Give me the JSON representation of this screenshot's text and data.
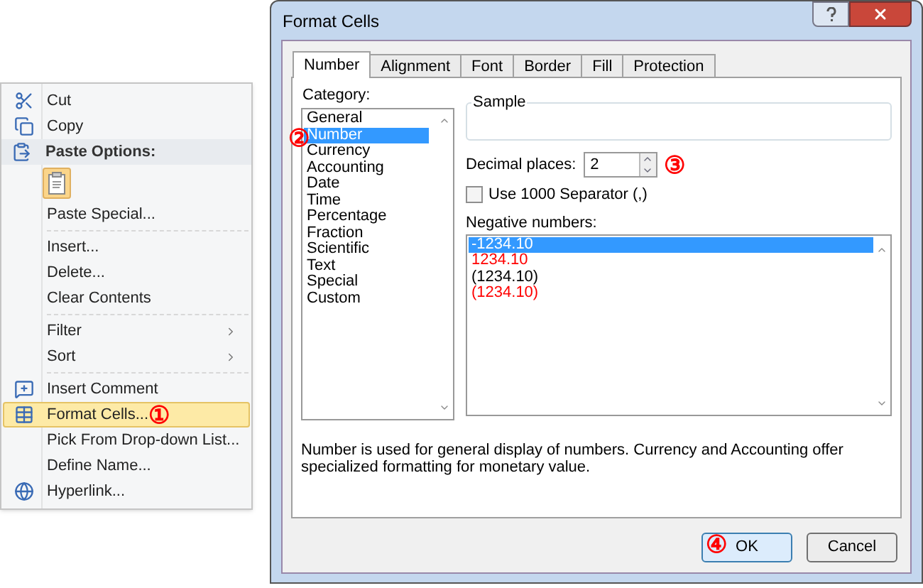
{
  "context_menu": {
    "items": [
      {
        "kind": "item",
        "label": "Cut",
        "submenu": false,
        "highlighted": false
      },
      {
        "kind": "item",
        "label": "Copy",
        "submenu": false,
        "highlighted": false
      },
      {
        "kind": "header",
        "label": "Paste Options:"
      },
      {
        "kind": "paste-option"
      },
      {
        "kind": "item",
        "label": "Paste Special...",
        "submenu": false,
        "highlighted": false
      },
      {
        "kind": "separator"
      },
      {
        "kind": "item",
        "label": "Insert...",
        "submenu": false,
        "highlighted": false
      },
      {
        "kind": "item",
        "label": "Delete...",
        "submenu": false,
        "highlighted": false
      },
      {
        "kind": "item",
        "label": "Clear Contents",
        "submenu": false,
        "highlighted": false
      },
      {
        "kind": "separator"
      },
      {
        "kind": "item",
        "label": "Filter",
        "submenu": true,
        "highlighted": false
      },
      {
        "kind": "item",
        "label": "Sort",
        "submenu": true,
        "highlighted": false
      },
      {
        "kind": "separator"
      },
      {
        "kind": "item",
        "label": "Insert Comment",
        "submenu": false,
        "highlighted": false
      },
      {
        "kind": "item",
        "label": "Format Cells...",
        "submenu": false,
        "highlighted": true,
        "annotation": "①"
      },
      {
        "kind": "item",
        "label": "Pick From Drop-down List...",
        "submenu": false,
        "highlighted": false
      },
      {
        "kind": "item",
        "label": "Define Name...",
        "submenu": false,
        "highlighted": false
      },
      {
        "kind": "item",
        "label": "Hyperlink...",
        "submenu": false,
        "highlighted": false
      }
    ]
  },
  "dialog": {
    "title": "Format Cells",
    "tabs": [
      {
        "label": "Number",
        "selected": true
      },
      {
        "label": "Alignment",
        "selected": false
      },
      {
        "label": "Font",
        "selected": false
      },
      {
        "label": "Border",
        "selected": false
      },
      {
        "label": "Fill",
        "selected": false
      },
      {
        "label": "Protection",
        "selected": false
      }
    ],
    "category": {
      "label": "Category:",
      "annotation": "②",
      "items": [
        {
          "label": "General",
          "selected": false
        },
        {
          "label": "Number",
          "selected": true
        },
        {
          "label": "Currency",
          "selected": false
        },
        {
          "label": "Accounting",
          "selected": false
        },
        {
          "label": "Date",
          "selected": false
        },
        {
          "label": "Time",
          "selected": false
        },
        {
          "label": "Percentage",
          "selected": false
        },
        {
          "label": "Fraction",
          "selected": false
        },
        {
          "label": "Scientific",
          "selected": false
        },
        {
          "label": "Text",
          "selected": false
        },
        {
          "label": "Special",
          "selected": false
        },
        {
          "label": "Custom",
          "selected": false
        }
      ]
    },
    "sample": {
      "label": "Sample"
    },
    "decimal_places": {
      "label": "Decimal places:",
      "value": "2",
      "annotation": "③"
    },
    "separator_checkbox": {
      "label": "Use 1000 Separator (,)",
      "checked": false
    },
    "negative_numbers": {
      "label": "Negative numbers:",
      "items": [
        {
          "label": "-1234.10",
          "selected": true
        },
        {
          "label": "1234.10",
          "selected": false,
          "color": "#ff0000"
        },
        {
          "label": "(1234.10)",
          "selected": false
        },
        {
          "label": "(1234.10)",
          "selected": false,
          "color": "#ff0000"
        }
      ]
    },
    "description": "Number is used for general display of numbers.  Currency and Accounting offer specialized formatting for monetary value.",
    "buttons": [
      {
        "label": "OK",
        "default": true,
        "annotation": "④"
      },
      {
        "label": "Cancel",
        "default": false
      }
    ]
  }
}
